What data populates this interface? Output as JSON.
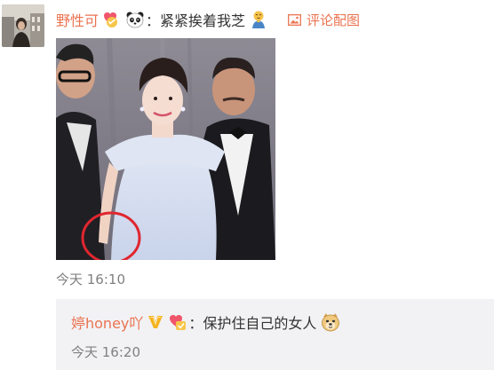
{
  "comment": {
    "username": "野性可",
    "colon": "：",
    "text": "紧紧挨着我芝",
    "image_link_label": "评论配图",
    "time": "今天 16:10",
    "icons": [
      "heart-badge-icon",
      "panda-emoji-icon",
      "praying-emoji-icon",
      "image-icon"
    ]
  },
  "reply": {
    "username": "婷honey吖",
    "colon": "：",
    "text": "保护住自己的女人",
    "time": "今天 16:20",
    "icons": [
      "vip-v-icon",
      "heart-badge-icon",
      "doge-emoji-icon"
    ]
  },
  "colors": {
    "link": "#eb7350",
    "text": "#333333",
    "time": "#808080",
    "reply_bg": "#f2f2f5"
  }
}
